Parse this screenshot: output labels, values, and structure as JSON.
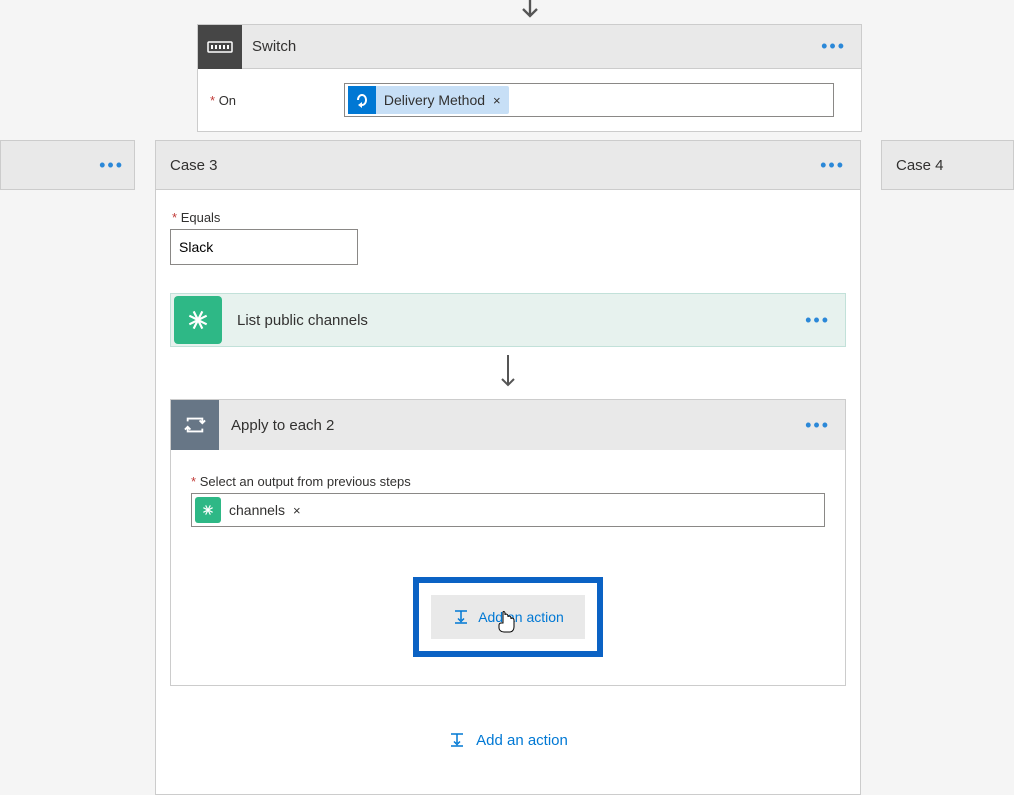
{
  "switch": {
    "title": "Switch",
    "on_label": "On",
    "token_label": "Delivery Method"
  },
  "case_prev_label": "",
  "case3": {
    "title": "Case 3",
    "equals_label": "Equals",
    "equals_value": "Slack"
  },
  "case4_title": "Case 4",
  "slack_action": {
    "title": "List public channels"
  },
  "apply": {
    "title": "Apply to each 2",
    "select_label": "Select an output from previous steps",
    "chip_label": "channels",
    "add_action": "Add an action"
  },
  "bottom_add": "Add an action"
}
